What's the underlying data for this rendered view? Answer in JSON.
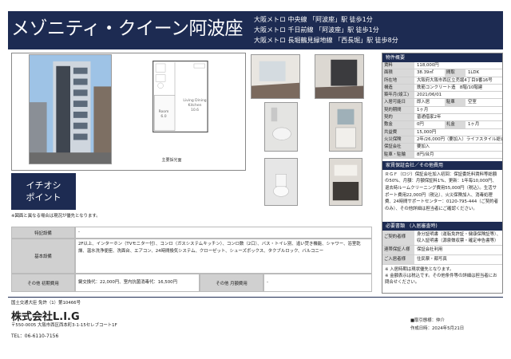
{
  "header": {
    "title": "メゾニティ・クイーン阿波座",
    "stations": [
      "大阪メトロ 中央線 「阿波座」駅 徒歩1分",
      "大阪メトロ 千日前線 「阿波座」駅 徒歩1分",
      "大阪メトロ 長堀鶴見緑地線 「西長堀」駅 徒歩8分"
    ]
  },
  "floorplan": {
    "room_a": "Room",
    "room_a_size": "6.0",
    "room_b": "Living Dining Kitchen",
    "room_b_size": "10.6",
    "balcony_label": "主要採光面"
  },
  "ichioshi": [
    "イチオシ",
    "ポイント"
  ],
  "notice": "※図面と異なる場合は現況が優先となります。",
  "left_table": {
    "row1_label": "特記設備",
    "row1_value": "-",
    "row2_label": "基本設備",
    "row2_value": "2F以上、インターホン（TVモニター付）、コンロ（ガスシステムキッチン）、コンロ数（2口）、バス・トイレ別、追い焚き機能、シャワー、浴室乾燥、温水洗浄便座、洗面台、エアコン、24時間換気システム、クローゼット、シューズボックス、タクブルロック、バルコニー",
    "row3_label": "その他 初期費用",
    "row3_value": "鍵交換代：22,000円、室内抗菌消毒代：16,500円",
    "row4_label": "その他 月額費用",
    "row4_value": "-"
  },
  "details": {
    "section_title": "物件概要",
    "rows": [
      {
        "label": "賃料",
        "value": "118,000円"
      },
      {
        "label": "面積",
        "value": "38.39㎡",
        "label2": "間取",
        "value2": "1LDK"
      },
      {
        "label": "所在地",
        "value": "大阪府大阪市西区立売堀4丁目9番16号"
      },
      {
        "label": "構造",
        "value": "鉄筋コンクリート造　8階/10階建"
      },
      {
        "label": "築年月(竣工)",
        "value": "2021/06/01"
      },
      {
        "label": "入居可能日",
        "value": "即入居",
        "label2": "駐車",
        "value2": "空室"
      },
      {
        "label": "契約期間",
        "value": "1ヶ月"
      },
      {
        "label": "契約",
        "value": "普通借家2年"
      },
      {
        "label": "敷金",
        "value": "0円",
        "label2": "礼金",
        "value2": "1ヶ月"
      },
      {
        "label": "共益費",
        "value": "15,000円"
      },
      {
        "label": "火災保険",
        "value": "2年/26,000円（要加入）ライフスタイル総合保険"
      },
      {
        "label": "保証会社",
        "value": "要加入"
      },
      {
        "label": "駐車・駐輪",
        "value": "8円/台月"
      }
    ],
    "guarantor_title": "家賃保証会社／その他費用",
    "guarantor_text": "ＲＧＦ（ロジ）保証会社加入初回：保証委託料賃料等総額の50%、月額：月額保証料1%、更新：1年毎10,000円、退去時ルームクリーニング費用55,000円（税込）。生活サポート費用22,000円（税込）、火災保険加入、消毒処理費、24時間サポートセンター：0120-795-444（ご契約者のみ）、その他詳細は担当者にご確認ください。",
    "move_title": "必要書類　(入居審査時)",
    "move_rows": [
      {
        "label": "ご契約者様",
        "value": "身分証明書（運転免許証・健康保険証等）、収入証明書（源泉徴収票・確定申告書等）"
      },
      {
        "label": "連帯保証人様",
        "value": "保証会社利用"
      },
      {
        "label": "ご入居者様",
        "value": "住民票・顔写真"
      }
    ],
    "remarks": [
      "※ 入居時期は現状優先となります。",
      "※ 金額表示は税込です。その他条件等の詳細は担当者にお問合せください。"
    ]
  },
  "footer": {
    "license": "国土交通大臣 免許（1）第10466号",
    "company": "株式会社L.I.G",
    "address": "〒550-0005 大阪市西区西本町3-1-15セレブコート1F",
    "tel": "TEL：06-6110-7156",
    "trade": "■取引態様：仲介",
    "updated": "作成日時：2024年5月21日"
  },
  "colors": {
    "navy": "#1d2b52"
  }
}
